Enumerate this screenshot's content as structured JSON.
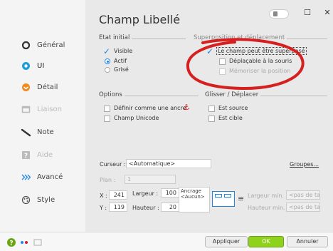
{
  "window": {
    "title": "Champ Libellé",
    "close_glyph": "✕",
    "max_glyph": "☐"
  },
  "sidebar": {
    "items": [
      {
        "label": "Général",
        "icon": "circle-icon"
      },
      {
        "label": "UI",
        "icon": "eye-icon"
      },
      {
        "label": "Détail",
        "icon": "detail-icon"
      },
      {
        "label": "Liaison",
        "icon": "link-icon"
      },
      {
        "label": "Note",
        "icon": "pen-icon"
      },
      {
        "label": "Aide",
        "icon": "help-icon"
      },
      {
        "label": "Avancé",
        "icon": "chevrons-icon"
      },
      {
        "label": "Style",
        "icon": "palette-icon"
      }
    ]
  },
  "etat": {
    "title": "Etat initial",
    "visible": "Visible",
    "actif": "Actif",
    "grise": "Grisé"
  },
  "superposition": {
    "title": "Superposition et déplacement",
    "superpose": "Le champ peut être superposé",
    "deplacable": "Déplaçable à la souris",
    "memoriser": "Mémoriser la position"
  },
  "options": {
    "title": "Options",
    "ancre": "Définir comme une ancre",
    "unicode": "Champ Unicode"
  },
  "glisser": {
    "title": "Glisser / Déplacer",
    "source": "Est source",
    "cible": "Est cible"
  },
  "curseur": {
    "label": "Curseur :",
    "value": "<Automatique>",
    "groupes": "Groupes..."
  },
  "plan": {
    "label": "Plan :",
    "value": "1"
  },
  "geometry": {
    "x_label": "X :",
    "x_value": "241",
    "y_label": "Y :",
    "y_value": "119",
    "largeur_label": "Largeur :",
    "largeur_value": "100",
    "hauteur_label": "Hauteur :",
    "hauteur_value": "20",
    "ancrage_label": "Ancrage",
    "ancrage_value": "<Aucun>",
    "largeur_min_label": "Largeur min. :",
    "largeur_min_value": "<pas de ta",
    "hauteur_min_label": "Hauteur min. :",
    "hauteur_min_value": "<pas de ta"
  },
  "buttons": {
    "appliquer": "Appliquer",
    "ok": "OK",
    "annuler": "Annuler"
  },
  "colors": {
    "accent": "#1e88e5",
    "ok_green": "#8fd21b",
    "annotation_red": "#d62020"
  }
}
